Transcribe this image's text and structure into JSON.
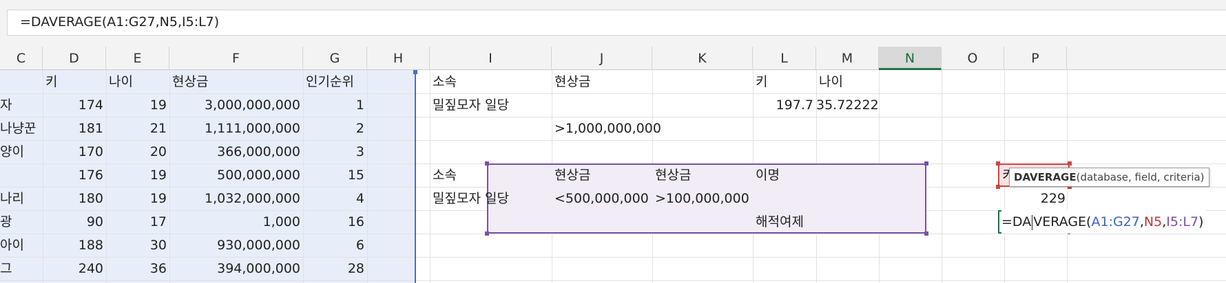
{
  "formula_bar": {
    "text": "=DAVERAGE(A1:G27,N5,I5:L7)"
  },
  "columns": [
    {
      "id": "C",
      "label": "C"
    },
    {
      "id": "D",
      "label": "D"
    },
    {
      "id": "E",
      "label": "E"
    },
    {
      "id": "F",
      "label": "F"
    },
    {
      "id": "G",
      "label": "G"
    },
    {
      "id": "H",
      "label": "H"
    },
    {
      "id": "I",
      "label": "I"
    },
    {
      "id": "J",
      "label": "J"
    },
    {
      "id": "K",
      "label": "K"
    },
    {
      "id": "L",
      "label": "L"
    },
    {
      "id": "M",
      "label": "M"
    },
    {
      "id": "N",
      "label": "N"
    },
    {
      "id": "O",
      "label": "O"
    },
    {
      "id": "P",
      "label": "P"
    }
  ],
  "active_column": "N",
  "rows": [
    {
      "C": "",
      "D": "키",
      "E": "나이",
      "F": "현상금",
      "G": "인기순위",
      "I": "소속",
      "J": "현상금",
      "K": "",
      "L": "키",
      "M": "나이",
      "N": ""
    },
    {
      "C": "자",
      "D": "174",
      "E": "19",
      "F": "3,000,000,000",
      "G": "1",
      "I": "밀짚모자 일당",
      "J": "",
      "K": "",
      "L": "197.7",
      "M": "35.72222",
      "N": ""
    },
    {
      "C": "나냥꾼",
      "D": "181",
      "E": "21",
      "F": "1,111,000,000",
      "G": "2",
      "I": "",
      "J": ">1,000,000,000",
      "K": "",
      "L": "",
      "M": "",
      "N": ""
    },
    {
      "C": "양이",
      "D": "170",
      "E": "20",
      "F": "366,000,000",
      "G": "3",
      "I": "",
      "J": "",
      "K": "",
      "L": "",
      "M": "",
      "N": ""
    },
    {
      "C": "",
      "D": "176",
      "E": "19",
      "F": "500,000,000",
      "G": "15",
      "I": "소속",
      "J": "현상금",
      "K": "현상금",
      "L": "이명",
      "M": "",
      "N": "키"
    },
    {
      "C": "나리",
      "D": "180",
      "E": "19",
      "F": "1,032,000,000",
      "G": "4",
      "I": "밀짚모자 일당",
      "J": "<500,000,000",
      "K": ">100,000,000",
      "L": "",
      "M": "",
      "N": "229"
    },
    {
      "C": "광",
      "D": "90",
      "E": "17",
      "F": "1,000",
      "G": "16",
      "I": "",
      "J": "",
      "K": "",
      "L": "해적여제",
      "M": "",
      "N": ""
    },
    {
      "C": " 아이",
      "D": "188",
      "E": "30",
      "F": "930,000,000",
      "G": "6",
      "I": "",
      "J": "",
      "K": "",
      "L": "",
      "M": "",
      "N": ""
    },
    {
      "C": "그",
      "D": "240",
      "E": "36",
      "F": "394,000,000",
      "G": "28",
      "I": "",
      "J": "",
      "K": "",
      "L": "",
      "M": "",
      "N": ""
    }
  ],
  "editing_cell": {
    "ref": "N7",
    "parts": {
      "head": "=DA",
      "tail": "VERAGE(",
      "ref1": "A1:G27",
      "sep1": ",",
      "ref2": "N5",
      "sep2": ",",
      "ref3": "I5:L7",
      "close": ")"
    }
  },
  "tooltip": {
    "function_name": "DAVERAGE",
    "args": "(database, field, criteria)"
  },
  "colors": {
    "data_range": "#4472c4",
    "criteria_range": "#7c4fa8",
    "field_ref": "#d24343",
    "active": "#217346"
  }
}
